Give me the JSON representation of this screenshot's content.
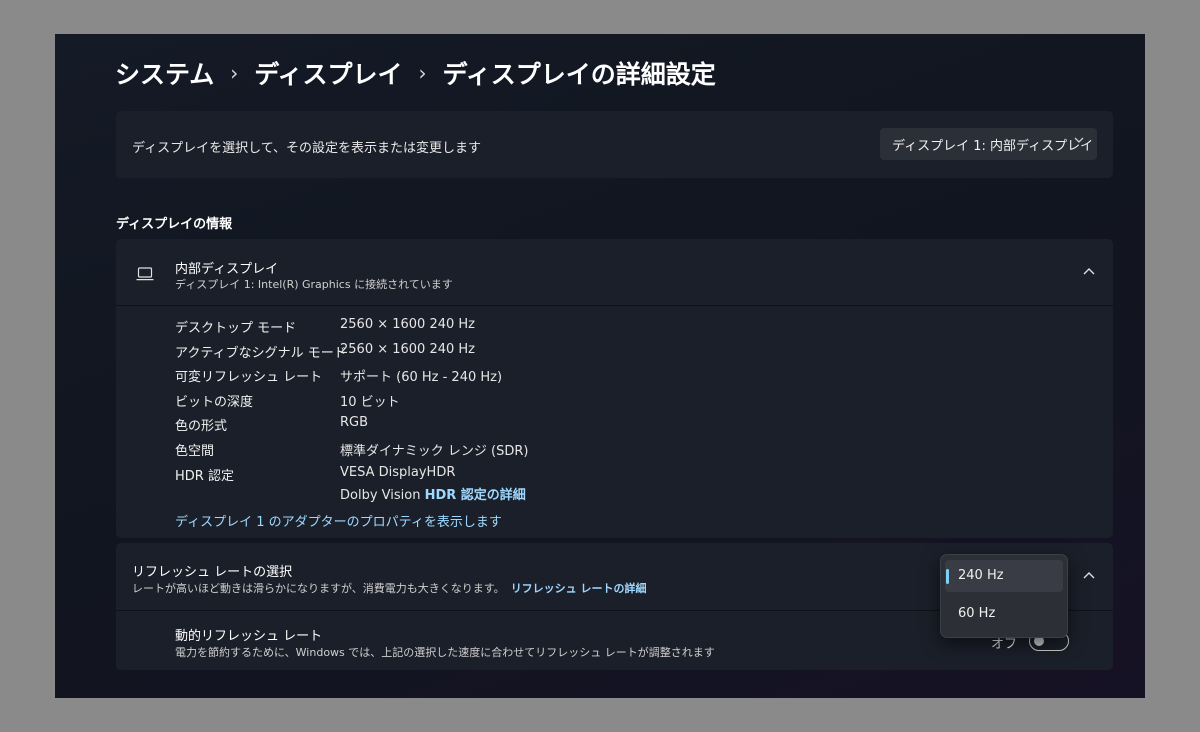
{
  "breadcrumb": {
    "items": [
      "システム",
      "ディスプレイ",
      "ディスプレイの詳細設定"
    ],
    "separator": "›"
  },
  "display_select": {
    "description": "ディスプレイを選択して、その設定を表示または変更します",
    "selected": "ディスプレイ 1: 内部ディスプレイ"
  },
  "info_section": {
    "title": "ディスプレイの情報"
  },
  "display_info": {
    "name": "内部ディスプレイ",
    "connection": "ディスプレイ 1: Intel(R) Graphics に接続されています",
    "rows": [
      {
        "label": "デスクトップ モード",
        "value": "2560 × 1600 240 Hz"
      },
      {
        "label": "アクティブなシグナル モード",
        "value": "2560 × 1600 240 Hz"
      },
      {
        "label": "可変リフレッシュ レート",
        "value": "サポート (60 Hz - 240 Hz)"
      },
      {
        "label": "ビットの深度",
        "value": "10 ビット"
      },
      {
        "label": "色の形式",
        "value": "RGB"
      },
      {
        "label": "色空間",
        "value": "標準ダイナミック レンジ (SDR)"
      },
      {
        "label": "HDR 認定",
        "value": "VESA DisplayHDR",
        "value2_prefix": "Dolby Vision ",
        "value2_link": "HDR 認定の詳細"
      }
    ],
    "adapter_link": "ディスプレイ 1 のアダプターのプロパティを表示します"
  },
  "refresh": {
    "title": "リフレッシュ レートの選択",
    "description": "レートが高いほど動きは滑らかになりますが、消費電力も大きくなります。",
    "link": "リフレッシュ レートの詳細",
    "options": [
      "240 Hz",
      "60 Hz"
    ],
    "selected": "240 Hz"
  },
  "dynamic_refresh": {
    "title": "動的リフレッシュ レート",
    "description": "電力を節約するために、Windows では、上記の選択した速度に合わせてリフレッシュ レートが調整されます",
    "state_label": "オフ",
    "enabled": false
  },
  "colors": {
    "accent": "#7fd0f5",
    "link": "#9fd8ff",
    "card": "#1b1f29"
  }
}
